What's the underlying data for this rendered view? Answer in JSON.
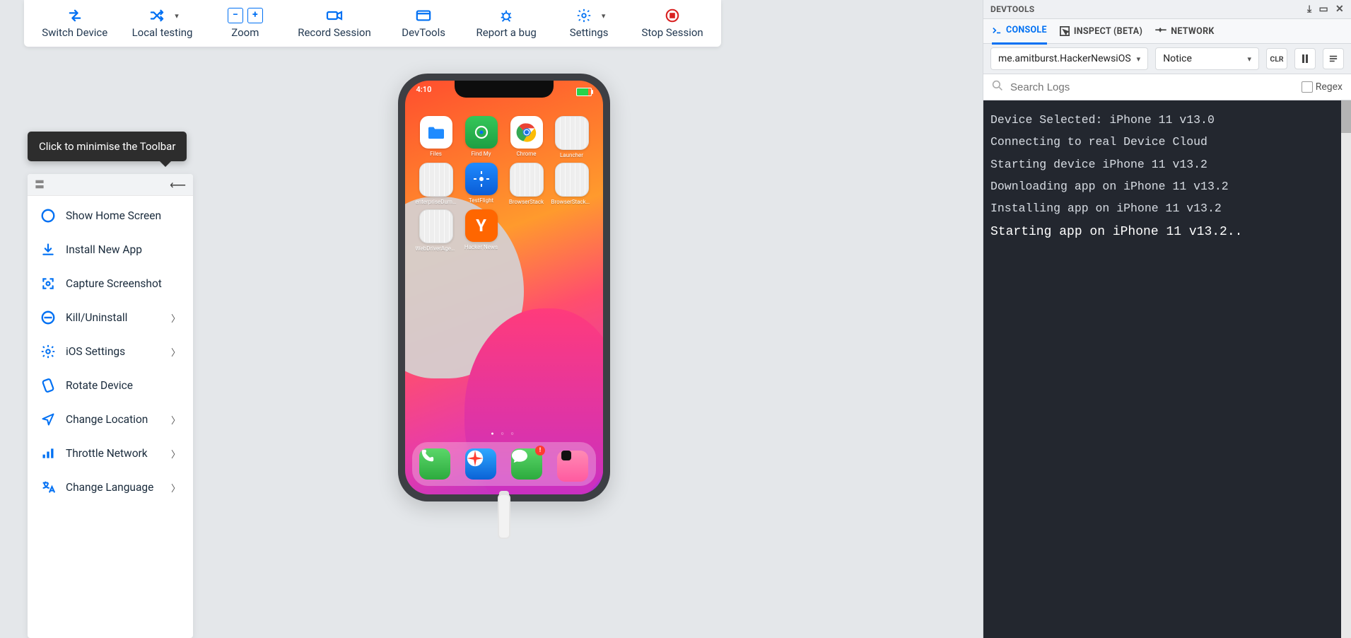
{
  "toolbar": {
    "items": [
      {
        "label": "Switch Device",
        "icon": "swap"
      },
      {
        "label": "Local testing",
        "icon": "shuffle",
        "dropdown": true
      },
      {
        "label": "Zoom",
        "icon": "zoom"
      },
      {
        "label": "Record Session",
        "icon": "record"
      },
      {
        "label": "DevTools",
        "icon": "panel"
      },
      {
        "label": "Report a bug",
        "icon": "bug"
      },
      {
        "label": "Settings",
        "icon": "gear",
        "dropdown": true
      },
      {
        "label": "Stop Session",
        "icon": "stop",
        "red": true
      }
    ]
  },
  "tooltip": "Click to minimise the Toolbar",
  "sidebar": {
    "items": [
      {
        "label": "Show Home Screen",
        "icon": "home",
        "chev": false
      },
      {
        "label": "Install New App",
        "icon": "download",
        "chev": false
      },
      {
        "label": "Capture Screenshot",
        "icon": "capture",
        "chev": false
      },
      {
        "label": "Kill/Uninstall",
        "icon": "nokill",
        "chev": true
      },
      {
        "label": "iOS Settings",
        "icon": "gear",
        "chev": true
      },
      {
        "label": "Rotate Device",
        "icon": "rotate",
        "chev": false
      },
      {
        "label": "Change Location",
        "icon": "loc",
        "chev": true
      },
      {
        "label": "Throttle Network",
        "icon": "bars",
        "chev": true
      },
      {
        "label": "Change Language",
        "icon": "lang",
        "chev": true
      }
    ]
  },
  "device": {
    "time": "4:10",
    "apps_row1": [
      {
        "label": "Files",
        "kind": "files"
      },
      {
        "label": "Find My",
        "kind": "findmy"
      },
      {
        "label": "Chrome",
        "kind": "chrome"
      },
      {
        "label": "Launcher",
        "kind": "placeholder"
      }
    ],
    "apps_row2": [
      {
        "label": "enterpriseDummy",
        "kind": "placeholder"
      },
      {
        "label": "TestFlight",
        "kind": "testflight"
      },
      {
        "label": "BrowserStack",
        "kind": "placeholder"
      },
      {
        "label": "BrowserStackUI...",
        "kind": "placeholder"
      }
    ],
    "apps_row3": [
      {
        "label": "WebDriverAgen...",
        "kind": "placeholder"
      },
      {
        "label": "Hacker News",
        "kind": "hn"
      }
    ],
    "dock": [
      {
        "kind": "phone"
      },
      {
        "kind": "safari"
      },
      {
        "kind": "messages",
        "badge": "!"
      },
      {
        "kind": "blankpink"
      }
    ],
    "pager": "● ○ ○"
  },
  "devtools": {
    "title": "DEVTOOLS",
    "tabs": [
      {
        "label": "CONSOLE",
        "active": true
      },
      {
        "label": "INSPECT (BETA)",
        "active": false
      },
      {
        "label": "NETWORK",
        "active": false
      }
    ],
    "process_dd": "me.amitburst.HackerNewsiOS",
    "level_dd": "Notice",
    "clr": "CLR",
    "search_placeholder": "Search Logs",
    "regex_label": "Regex",
    "log": [
      {
        "t": "Device Selected: iPhone 11 v13.0"
      },
      {
        "t": "Connecting to real Device Cloud"
      },
      {
        "t": "Starting device iPhone 11 v13.2"
      },
      {
        "t": "Downloading app on iPhone 11 v13.2"
      },
      {
        "t": "Installing app on iPhone 11 v13.2"
      },
      {
        "t": "Starting app on iPhone 11 v13.2..",
        "emph": true
      }
    ]
  }
}
